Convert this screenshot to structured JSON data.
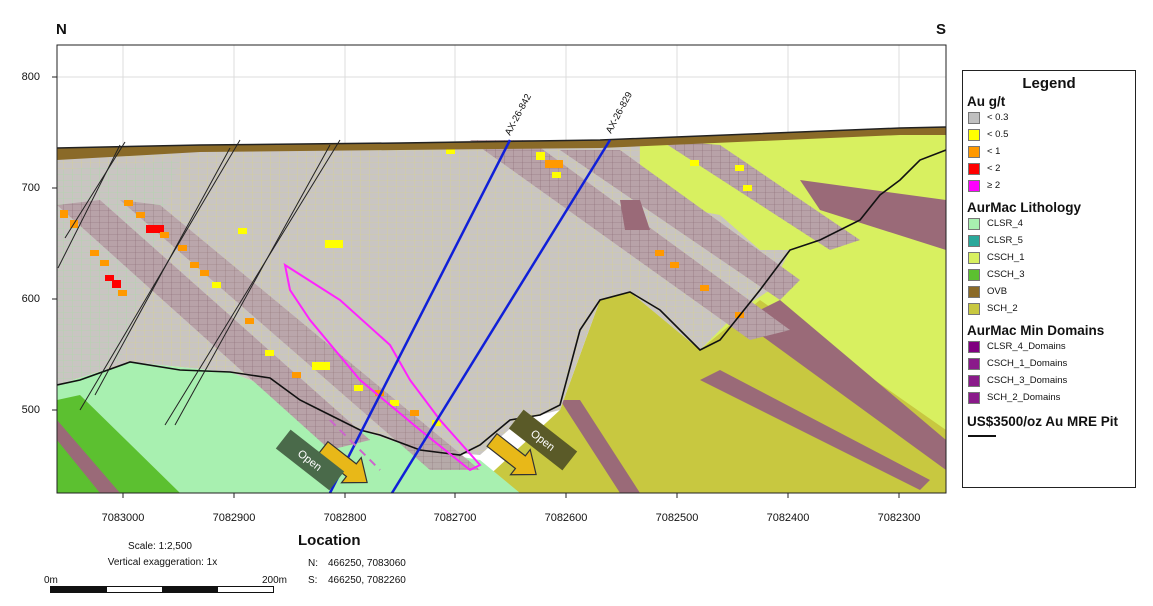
{
  "compass": {
    "north": "N",
    "south": "S"
  },
  "y_axis": {
    "ticks": [
      "800",
      "700",
      "600",
      "500"
    ]
  },
  "x_axis": {
    "ticks": [
      "7083000",
      "7082900",
      "7082800",
      "7082700",
      "7082600",
      "7082500",
      "7082400",
      "7082300"
    ]
  },
  "drillholes": [
    {
      "id": "AX-26-842",
      "color": "#1020d8"
    },
    {
      "id": "AX-26-829",
      "color": "#1020d8"
    }
  ],
  "open_labels": [
    "Open",
    "Open"
  ],
  "legend": {
    "title": "Legend",
    "au": {
      "title": "Au g/t",
      "items": [
        {
          "label": "< 0.3",
          "color": "#c0c0c0"
        },
        {
          "label": "< 0.5",
          "color": "#ffff00"
        },
        {
          "label": "< 1",
          "color": "#ff9900"
        },
        {
          "label": "< 2",
          "color": "#ff0000"
        },
        {
          "label": "≥ 2",
          "color": "#ff00ff"
        }
      ]
    },
    "lithology": {
      "title": "AurMac Lithology",
      "items": [
        {
          "label": "CLSR_4",
          "color": "#a8f0b0"
        },
        {
          "label": "CLSR_5",
          "color": "#2aa89a"
        },
        {
          "label": "CSCH_1",
          "color": "#d8f060"
        },
        {
          "label": "CSCH_3",
          "color": "#5cc030"
        },
        {
          "label": "OVB",
          "color": "#8a6a28"
        },
        {
          "label": "SCH_2",
          "color": "#c8c840"
        }
      ]
    },
    "domains": {
      "title": "AurMac Min Domains",
      "items": [
        {
          "label": "CLSR_4_Domains",
          "color": "#800080"
        },
        {
          "label": "CSCH_1_Domains",
          "color": "#8a1a8a"
        },
        {
          "label": "CSCH_3_Domains",
          "color": "#8a1a8a"
        },
        {
          "label": "SCH_2_Domains",
          "color": "#8a1a8a"
        }
      ]
    },
    "pit": {
      "title": "US$3500/oz Au MRE Pit"
    }
  },
  "scale": {
    "ratio": "Scale: 1:2,500",
    "exaggeration": "Vertical exaggeration: 1x",
    "start": "0m",
    "end": "200m"
  },
  "location": {
    "title": "Location",
    "north_label": "N:",
    "north_value": "466250, 7083060",
    "south_label": "S:",
    "south_value": "466250, 7082260"
  }
}
